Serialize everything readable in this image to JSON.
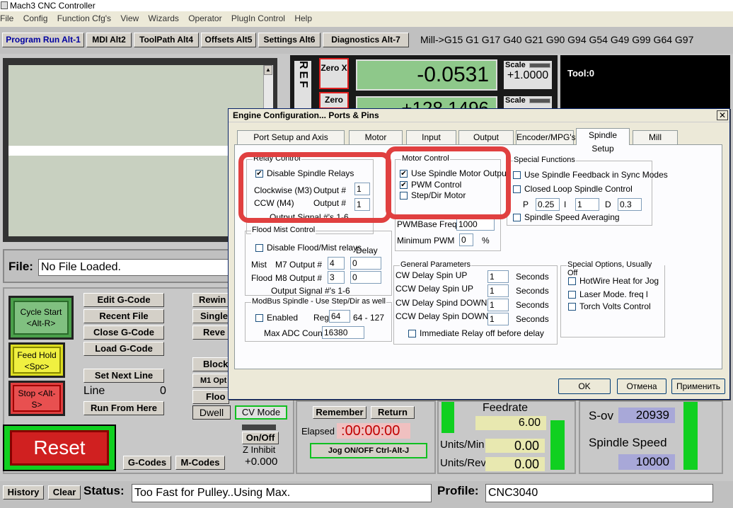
{
  "window": {
    "title": "Mach3 CNC Controller"
  },
  "menu": [
    "File",
    "Config",
    "Function Cfg's",
    "View",
    "Wizards",
    "Operator",
    "PlugIn Control",
    "Help"
  ],
  "top_tabs": [
    "Program Run Alt-1",
    "MDI Alt2",
    "ToolPath Alt4",
    "Offsets Alt5",
    "Settings Alt6",
    "Diagnostics Alt-7"
  ],
  "gcode_line": "Mill->G15  G1 G17 G40 G21 G90 G94 G54 G49 G99 G64 G97",
  "dro": {
    "ref_label": "REF",
    "zero_x": "Zero X",
    "zero_y": "Zero",
    "x_value": "-0.0531",
    "y_value": "+128.1496",
    "scale_label": "Scale",
    "scale_x": "+1.0000",
    "tool": "Tool:0"
  },
  "file": {
    "label": "File:",
    "value": "No File Loaded."
  },
  "buttons": {
    "cycle_start": "Cycle Start <Alt-R>",
    "feed_hold": "Feed Hold <Spc>",
    "stop": "Stop <Alt-S>",
    "reset": "Reset",
    "edit_gcode": "Edit G-Code",
    "recent_file": "Recent File",
    "close_gcode": "Close G-Code",
    "load_gcode": "Load G-Code",
    "set_next_line": "Set Next Line",
    "line_label": "Line",
    "line_value": "0",
    "run_from_here": "Run From Here",
    "rewind": "Rewin",
    "single": "Single",
    "reverse": "Reve",
    "block": "Block",
    "m1_opt": "M1 Opt",
    "flood": "Floo",
    "dwell": "Dwell",
    "cv_mode": "CV Mode",
    "on_off": "On/Off",
    "z_inhibit": "Z Inhibit",
    "z_inhibit_value": "+0.000",
    "gcodes": "G-Codes",
    "mcodes": "M-Codes",
    "remember": "Remember",
    "return": "Return",
    "elapsed_label": "Elapsed",
    "elapsed_value": "00:00:00",
    "jog": "Jog ON/OFF Ctrl-Alt-J",
    "history": "History",
    "clear": "Clear"
  },
  "feed": {
    "feedrate_label": "Feedrate",
    "feedrate_value": "6.00",
    "units_min_label": "Units/Min",
    "units_min_value": "0.00",
    "units_rev_label": "Units/Rev",
    "units_rev_value": "0.00"
  },
  "spindle": {
    "sov_label": "S-ov",
    "sov_value": "20939",
    "speed_label": "Spindle Speed",
    "speed_value": "10000"
  },
  "status": {
    "label": "Status:",
    "value": "Too Fast for Pulley..Using Max.",
    "profile_label": "Profile:",
    "profile_value": "CNC3040"
  },
  "dialog": {
    "title": "Engine Configuration... Ports & Pins",
    "tabs": [
      "Port Setup and Axis Selection",
      "Motor Outputs",
      "Input Signals",
      "Output Signals",
      "Encoder/MPG's",
      "Spindle Setup",
      "Mill Options"
    ],
    "relay": {
      "title": "Relay Control",
      "disable": "Disable Spindle Relays",
      "cw": "Clockwise (M3)",
      "ccw": "CCW (M4)",
      "output_hash": "Output #",
      "cw_value": "1",
      "ccw_value": "1",
      "signals": "Output Signal #'s 1-6"
    },
    "motor": {
      "title": "Motor Control",
      "use_spindle": "Use Spindle Motor Output",
      "pwm": "PWM Control",
      "stepdir": "Step/Dir Motor",
      "pwm_base_label": "PWMBase Freq.",
      "pwm_base_value": "1000",
      "min_pwm_label": "Minimum PWM",
      "min_pwm_value": "0",
      "pct": "%"
    },
    "special": {
      "title": "Special Functions",
      "feedback": "Use Spindle Feedback in Sync Modes",
      "closed_loop": "Closed Loop Spindle Control",
      "p": "P",
      "p_value": "0.25",
      "i": "I",
      "i_value": "1",
      "d": "D",
      "d_value": "0.3",
      "averaging": "Spindle Speed Averaging"
    },
    "flood": {
      "title": "Flood Mist Control",
      "disable": "Disable Flood/Mist relays",
      "delay": "Delay",
      "mist": "Mist",
      "flood": "Flood",
      "m7": "M7 Output #",
      "m8": "M8 Output #",
      "m7_value": "4",
      "m8_value": "3",
      "m7_delay": "0",
      "m8_delay": "0",
      "signals": "Output Signal #'s 1-6"
    },
    "modbus": {
      "title": "ModBus Spindle - Use Step/Dir as well",
      "enabled": "Enabled",
      "reg": "Reg",
      "reg_value": "64",
      "reg_range": "64 - 127",
      "max_adc": "Max ADC Count",
      "max_adc_value": "16380"
    },
    "general": {
      "title": "General Parameters",
      "rows": [
        {
          "label": "CW Delay Spin UP",
          "value": "1",
          "unit": "Seconds"
        },
        {
          "label": "CCW Delay Spin UP",
          "value": "1",
          "unit": "Seconds"
        },
        {
          "label": "CW Delay Spind DOWN",
          "value": "1",
          "unit": "Seconds"
        },
        {
          "label": "CCW Delay Spin DOWN",
          "value": "1",
          "unit": "Seconds"
        }
      ],
      "immediate": "Immediate Relay off before delay"
    },
    "special_options": {
      "title": "Special Options, Usually Off",
      "hotwire": "HotWire Heat for Jog",
      "laser": "Laser Mode. freq l",
      "torch": "Torch Volts Control"
    },
    "ok": "OK",
    "cancel": "Отмена",
    "apply": "Применить"
  }
}
